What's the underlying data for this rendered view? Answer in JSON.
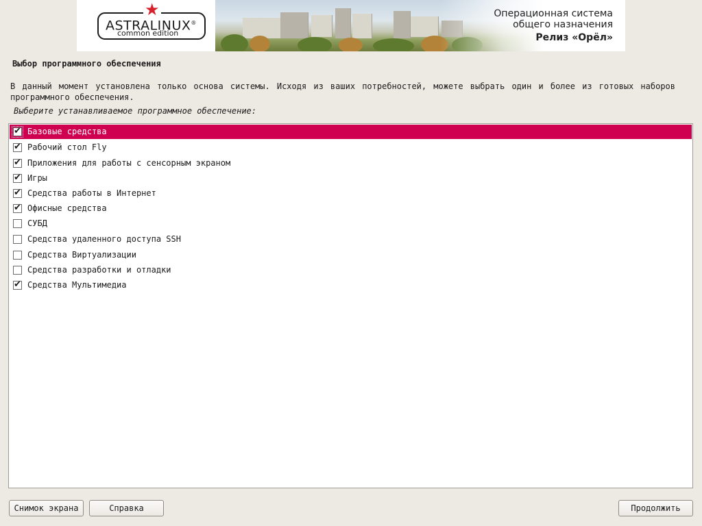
{
  "banner": {
    "logo_name": "ASTRALINUX",
    "logo_registered": "®",
    "logo_edition": "common edition",
    "os_line1": "Операционная система",
    "os_line2": "общего назначения",
    "os_release": "Релиз «Орёл»",
    "star_color": "#d6202a"
  },
  "page": {
    "title": "Выбор программного обеспечения",
    "description": "В данный момент установлена только основа системы. Исходя из ваших потребностей, можете выбрать один и более из готовых наборов программного обеспечения.",
    "prompt": "Выберите устанавливаемое программное обеспечение:"
  },
  "software": {
    "selected_color": "#cf0050",
    "check_mark": "✔",
    "items": [
      {
        "label": "Базовые средства",
        "checked": true,
        "selected": true
      },
      {
        "label": "Рабочий стол Fly",
        "checked": true
      },
      {
        "label": "Приложения для работы с сенсорным экраном",
        "checked": true
      },
      {
        "label": "Игры",
        "checked": true
      },
      {
        "label": "Средства работы в Интернет",
        "checked": true
      },
      {
        "label": "Офисные средства",
        "checked": true
      },
      {
        "label": "СУБД",
        "checked": false
      },
      {
        "label": "Средства удаленного доступа SSH",
        "checked": false
      },
      {
        "label": "Средства Виртуализации",
        "checked": false
      },
      {
        "label": "Средства разработки и отладки",
        "checked": false
      },
      {
        "label": "Средства Мультимедиа",
        "checked": true
      }
    ]
  },
  "buttons": {
    "screenshot": "Снимок экрана",
    "help": "Справка",
    "continue": "Продолжить"
  }
}
